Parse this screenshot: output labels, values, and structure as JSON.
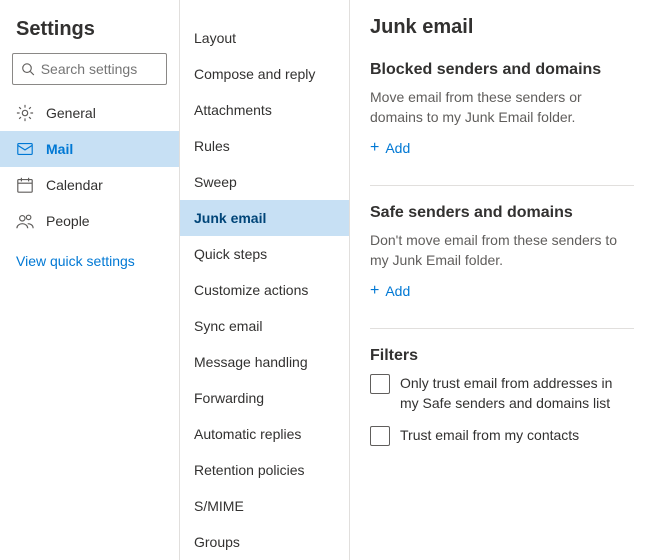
{
  "left": {
    "title": "Settings",
    "search_placeholder": "Search settings",
    "items": [
      {
        "label": "General",
        "icon": "gear"
      },
      {
        "label": "Mail",
        "icon": "mail"
      },
      {
        "label": "Calendar",
        "icon": "calendar"
      },
      {
        "label": "People",
        "icon": "people"
      }
    ],
    "quick_link": "View quick settings"
  },
  "middle": {
    "items": [
      "Layout",
      "Compose and reply",
      "Attachments",
      "Rules",
      "Sweep",
      "Junk email",
      "Quick steps",
      "Customize actions",
      "Sync email",
      "Message handling",
      "Forwarding",
      "Automatic replies",
      "Retention policies",
      "S/MIME",
      "Groups"
    ],
    "selected": "Junk email"
  },
  "right": {
    "title": "Junk email",
    "blocked": {
      "title": "Blocked senders and domains",
      "desc": "Move email from these senders or domains to my Junk Email folder.",
      "add": "Add"
    },
    "safe": {
      "title": "Safe senders and domains",
      "desc": "Don't move email from these senders to my Junk Email folder.",
      "add": "Add"
    },
    "filters": {
      "title": "Filters",
      "opt1": "Only trust email from addresses in my Safe senders and domains list",
      "opt2": "Trust email from my contacts"
    }
  }
}
